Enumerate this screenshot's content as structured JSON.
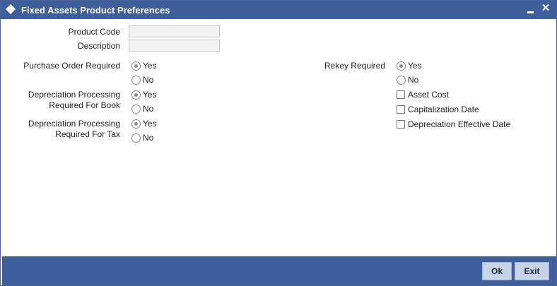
{
  "window": {
    "title": "Fixed Assets Product Preferences",
    "minimize_label": "",
    "close_label": "✕"
  },
  "fields": {
    "product_code": {
      "label": "Product Code",
      "value": ""
    },
    "description": {
      "label": "Description",
      "value": ""
    }
  },
  "purchase_order": {
    "label": "Purchase Order Required",
    "options": [
      {
        "label": "Yes",
        "selected": true
      },
      {
        "label": "No",
        "selected": false
      }
    ]
  },
  "dep_book": {
    "label_line1": "Depreciation Processing",
    "label_line2": "Required For Book",
    "options": [
      {
        "label": "Yes",
        "selected": true
      },
      {
        "label": "No",
        "selected": false
      }
    ]
  },
  "dep_tax": {
    "label_line1": "Depreciation Processing",
    "label_line2": "Required For Tax",
    "options": [
      {
        "label": "Yes",
        "selected": true
      },
      {
        "label": "No",
        "selected": false
      }
    ]
  },
  "rekey": {
    "label": "Rekey Required",
    "options": [
      {
        "label": "Yes",
        "selected": true
      },
      {
        "label": "No",
        "selected": false
      }
    ],
    "checkboxes": [
      {
        "label": "Asset Cost",
        "checked": false
      },
      {
        "label": "Capitalization Date",
        "checked": false
      },
      {
        "label": "Depreciation Effective Date",
        "checked": false
      }
    ]
  },
  "footer": {
    "ok_label": "Ok",
    "exit_label": "Exit"
  },
  "colors": {
    "titlebar": "#3f5e9c",
    "footer": "#3f5e9c",
    "button_bg": "#c7d3e6"
  }
}
